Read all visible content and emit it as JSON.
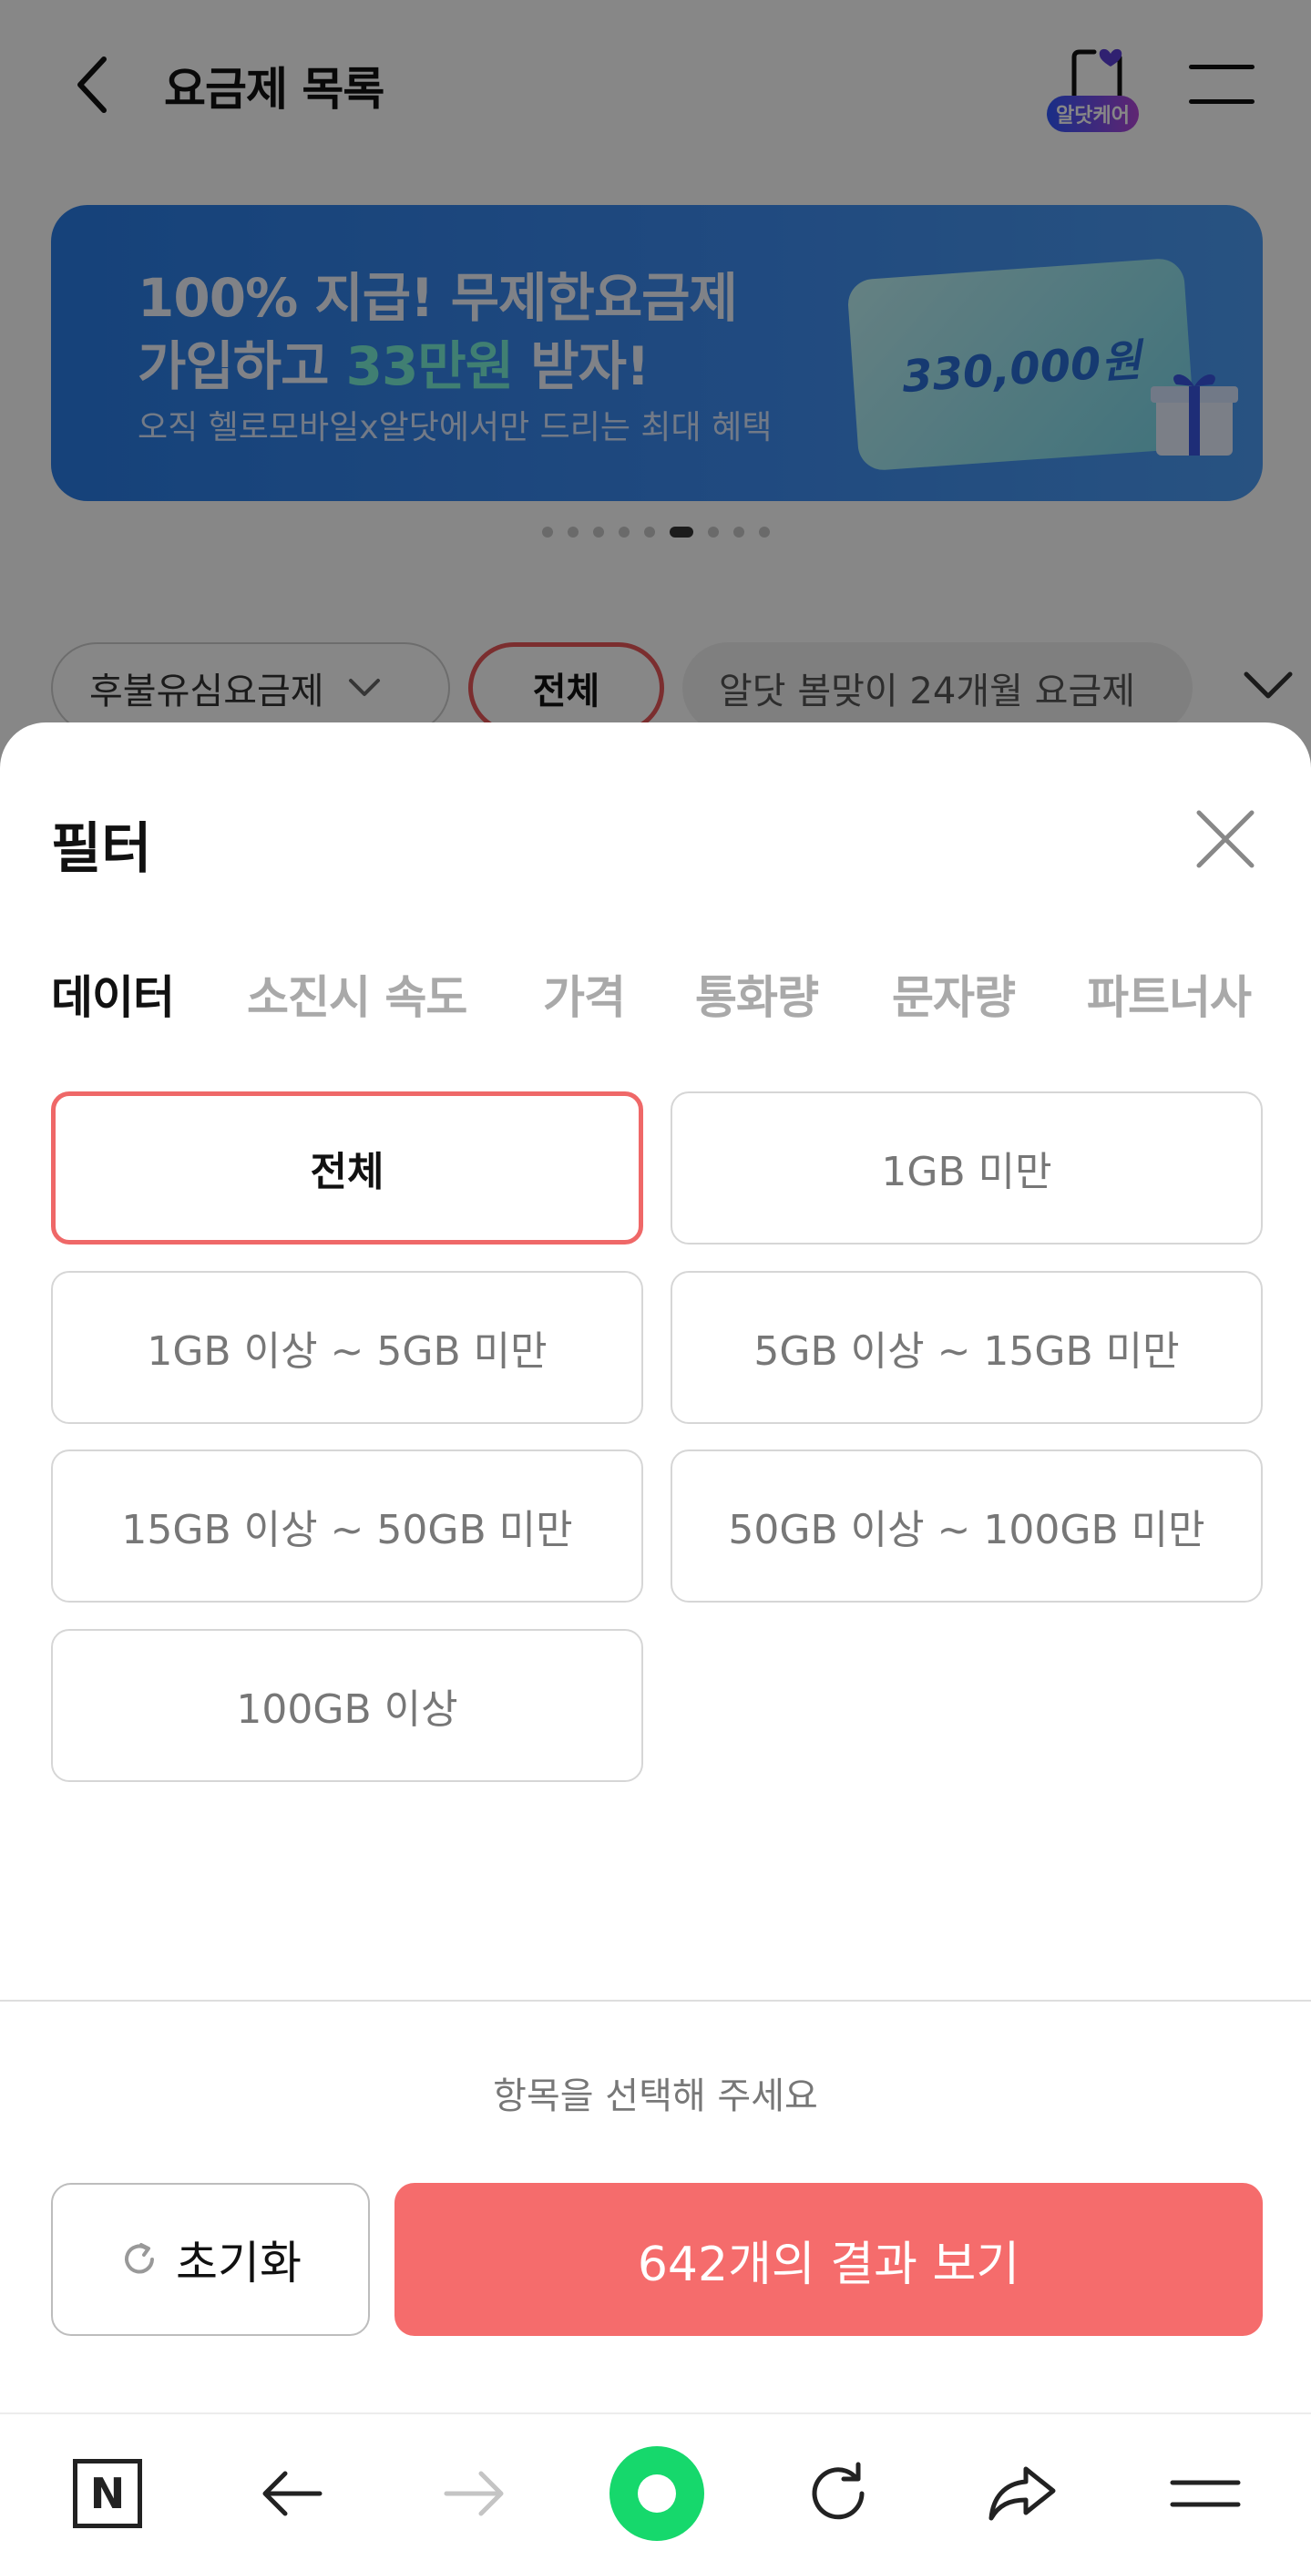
{
  "header": {
    "title": "요금제 목록",
    "aldot_care_label": "알닷케어"
  },
  "banner": {
    "line1": "100% 지급! 무제한요금제",
    "line2_prefix": "가입하고 ",
    "line2_highlight": "33만원",
    "line2_suffix": " 받자!",
    "subtitle": "오직 헬로모바일x알닷에서만 드리는 최대 혜택",
    "amount": "330,000원",
    "page_count": 9,
    "active_page": 6
  },
  "chips": {
    "plan_type": "후불유심요금제",
    "all": "전체",
    "event": "알닷 봄맞이 24개월 요금제"
  },
  "filter_sheet": {
    "title": "필터",
    "tabs": [
      {
        "label": "데이터",
        "active": true
      },
      {
        "label": "소진시 속도",
        "active": false
      },
      {
        "label": "가격",
        "active": false
      },
      {
        "label": "통화량",
        "active": false
      },
      {
        "label": "문자량",
        "active": false
      },
      {
        "label": "파트너사",
        "active": false
      }
    ],
    "options": [
      {
        "label": "전체",
        "selected": true
      },
      {
        "label": "1GB 미만",
        "selected": false
      },
      {
        "label": "1GB 이상 ~ 5GB 미만",
        "selected": false
      },
      {
        "label": "5GB 이상 ~ 15GB 미만",
        "selected": false
      },
      {
        "label": "15GB 이상 ~ 50GB 미만",
        "selected": false
      },
      {
        "label": "50GB 이상 ~ 100GB 미만",
        "selected": false
      },
      {
        "label": "100GB 이상",
        "selected": false
      }
    ],
    "hint": "항목을 선택해 주세요",
    "reset_label": "초기화",
    "result_label": "642개의 결과 보기"
  },
  "browser_bar": {
    "home_label": "N"
  },
  "colors": {
    "accent": "#f56c6c",
    "selected_border": "#ef6868",
    "banner_blue": "#3b8af0",
    "green": "#16d86c"
  }
}
